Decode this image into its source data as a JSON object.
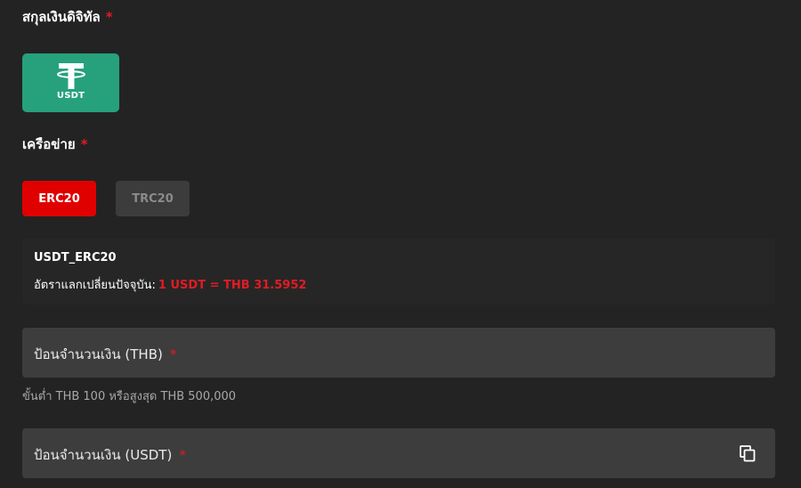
{
  "currency_section": {
    "label": "สกุลเงินดิจิทัล",
    "required_mark": "*",
    "options": [
      {
        "label": "USDT",
        "icon": "tether-icon",
        "color": "#26a17b",
        "selected": true
      }
    ]
  },
  "network_section": {
    "label": "เครือข่าย",
    "required_mark": "*",
    "options": [
      {
        "label": "ERC20",
        "selected": true
      },
      {
        "label": "TRC20",
        "selected": false
      }
    ]
  },
  "info": {
    "title": "USDT_ERC20",
    "rate_label": "อัตราแลกเปลี่ยนปัจจุบัน:",
    "rate_value": "1 USDT = THB 31.5952"
  },
  "amount_thb": {
    "label": "ป้อนจำนวนเงิน (THB)",
    "required_mark": "*",
    "hint": "ขั้นต่ำ THB 100 หรือสูงสุด THB 500,000"
  },
  "amount_usdt": {
    "label": "ป้อนจำนวนเงิน (USDT)",
    "required_mark": "*",
    "icon": "copy-icon"
  },
  "colors": {
    "background": "#232323",
    "accent_red": "#e00000",
    "tether_green": "#26a17b",
    "field_bg": "#3d3d3d"
  }
}
